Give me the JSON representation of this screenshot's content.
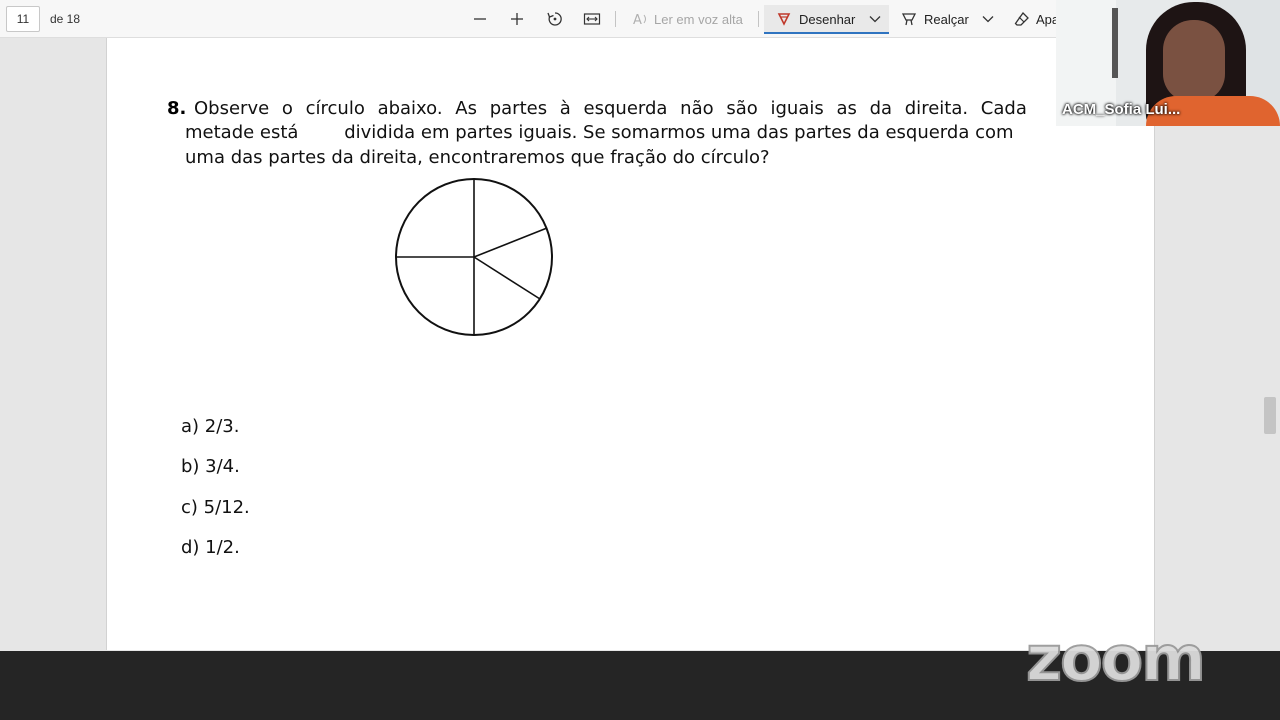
{
  "toolbar": {
    "page_current": "11",
    "page_total": "de 18",
    "read_aloud_label": "Ler em voz alta",
    "draw_label": "Desenhar",
    "highlight_label": "Realçar",
    "erase_label": "Apa",
    "accent_color": "#2f74c0",
    "draw_icon_color": "#c0392b",
    "icons": [
      "minus-icon",
      "plus-icon",
      "rotate-icon",
      "fit-width-icon",
      "read-aloud-icon",
      "pen-icon",
      "chevron-down-icon",
      "highlighter-icon",
      "eraser-icon"
    ]
  },
  "document": {
    "question_number": "8.",
    "question_line1": "Observe o círculo abaixo. As partes à esquerda não são iguais as da direita. Cada",
    "question_line2": "metade está        dividida em partes iguais. Se somarmos uma das partes da esquerda com",
    "question_line3": "uma das partes da direita, encontraremos que fração do círculo?",
    "options": [
      "a) 2/3.",
      "b) 3/4.",
      "c) 5/12.",
      "d) 1/2."
    ]
  },
  "overlay": {
    "participant_name": "ACM_Sofia Lui...",
    "zoom_logo": "zoom"
  }
}
